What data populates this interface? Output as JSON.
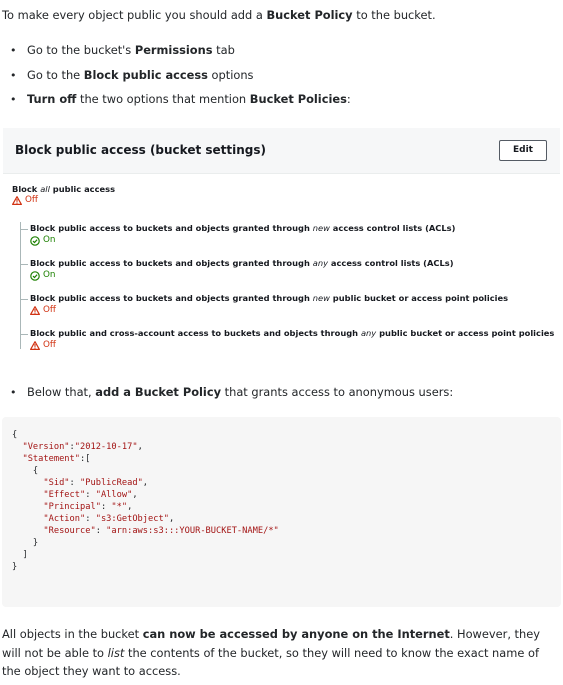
{
  "intro": {
    "pre": "To make every object public you should add a ",
    "bold": "Bucket Policy",
    "post": " to the bucket."
  },
  "steps": [
    {
      "pre": "Go to the bucket's ",
      "bold": "Permissions",
      "post": " tab"
    },
    {
      "pre": "Go to the ",
      "bold": "Block public access",
      "post": " options"
    },
    {
      "bold_a": "Turn off",
      "mid": " the two options that mention ",
      "bold_b": "Bucket Policies",
      "post": ":"
    }
  ],
  "panel": {
    "title": "Block public access (bucket settings)",
    "edit_label": "Edit",
    "all": {
      "pre": "Block ",
      "em": "all",
      "post": " public access",
      "status": "Off"
    },
    "options": [
      {
        "pre": "Block public access to buckets and objects granted through ",
        "em": "new",
        "post": " access control lists (ACLs)",
        "status": "On",
        "state": "on"
      },
      {
        "pre": "Block public access to buckets and objects granted through ",
        "em": "any",
        "post": " access control lists (ACLs)",
        "status": "On",
        "state": "on"
      },
      {
        "pre": "Block public access to buckets and objects granted through ",
        "em": "new",
        "post": " public bucket or access point policies",
        "status": "Off",
        "state": "off"
      },
      {
        "pre": "Block public and cross-account access to buckets and objects through ",
        "em": "any",
        "post": " public bucket or access point policies",
        "status": "Off",
        "state": "off"
      }
    ]
  },
  "below": {
    "pre": "Below that, ",
    "bold": "add a Bucket Policy",
    "post": " that grants access to anonymous users:"
  },
  "policy": {
    "Version": "2012-10-17",
    "Sid": "PublicRead",
    "Effect": "Allow",
    "Principal": "*",
    "Action": "s3:GetObject",
    "Resource": "arn:aws:s3:::YOUR-BUCKET-NAME/*"
  },
  "closing": {
    "pre": "All objects in the bucket ",
    "bold": "can now be accessed by anyone on the Internet",
    "mid": ". However, they will not be able to ",
    "em": "list",
    "post": " the contents of the bucket, so they will need to know the exact name of the object they want to access."
  },
  "colors": {
    "off": "#d13212",
    "on": "#1d8102"
  },
  "icons": {
    "off": "warning-triangle-icon",
    "on": "check-circle-icon"
  }
}
